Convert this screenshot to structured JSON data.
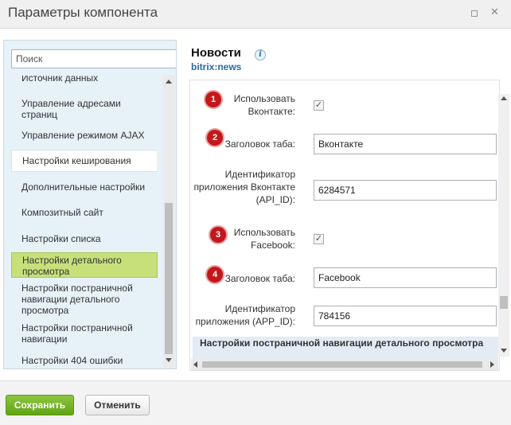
{
  "window": {
    "title": "Параметры компонента"
  },
  "search": {
    "placeholder": "Поиск"
  },
  "sidebar": {
    "items": [
      {
        "label": "Источник данных"
      },
      {
        "label": "Управление адресами страниц"
      },
      {
        "label": "Управление режимом AJAX"
      },
      {
        "label": "Настройки кеширования"
      },
      {
        "label": "Дополнительные настройки"
      },
      {
        "label": "Композитный сайт"
      },
      {
        "label": "Настройки списка"
      },
      {
        "label": "Настройки детального просмотра"
      },
      {
        "label": "Настройки постраничной навигации детального просмотра"
      },
      {
        "label": "Настройки постраничной навигации"
      },
      {
        "label": "Настройки 404 ошибки"
      }
    ],
    "selected_index": 7
  },
  "header": {
    "title": "Новости",
    "subtitle": "bitrix:news",
    "info_icon": "info-icon"
  },
  "form": {
    "fields": [
      {
        "badge": "1",
        "label": "Использовать Вконтакте:",
        "type": "checkbox",
        "checked": true
      },
      {
        "badge": "2",
        "label": "Заголовок таба:",
        "type": "text",
        "value": "Вконтакте"
      },
      {
        "badge": "",
        "label": "Идентификатор приложения Вконтакте (API_ID):",
        "type": "text",
        "value": "6284571"
      },
      {
        "badge": "3",
        "label": "Использовать Facebook:",
        "type": "checkbox",
        "checked": true
      },
      {
        "badge": "4",
        "label": "Заголовок таба:",
        "type": "text",
        "value": "Facebook"
      },
      {
        "badge": "",
        "label": "Идентификатор приложения (APP_ID):",
        "type": "text",
        "value": "784156"
      }
    ],
    "section_heading": "Настройки постраничной навигации детального просмотра"
  },
  "footer": {
    "save_label": "Сохранить",
    "cancel_label": "Отменить"
  },
  "colors": {
    "badge": "#c3171b",
    "selected_item": "#c7e07a",
    "save_button": "#6fb02a",
    "subtitle": "#2a6aa5",
    "sidebar_bg": "#e6f1f8"
  }
}
